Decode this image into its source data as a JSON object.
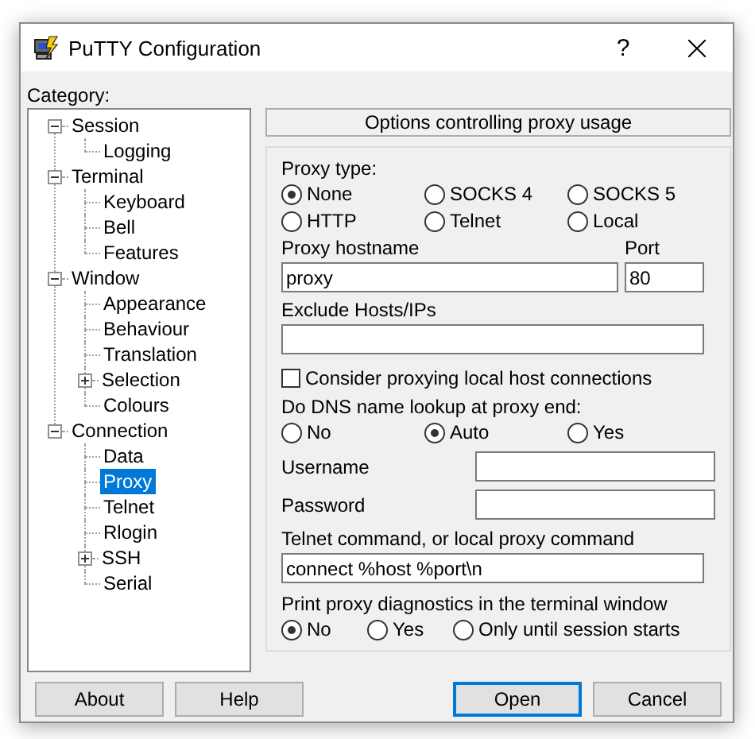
{
  "window": {
    "title": "PuTTY Configuration",
    "help_glyph": "?"
  },
  "category_label": "Category:",
  "tree": [
    {
      "label": "Session",
      "expanded": true,
      "selected": false,
      "children": [
        {
          "label": "Logging",
          "selected": false
        }
      ]
    },
    {
      "label": "Terminal",
      "expanded": true,
      "selected": false,
      "children": [
        {
          "label": "Keyboard",
          "selected": false
        },
        {
          "label": "Bell",
          "selected": false
        },
        {
          "label": "Features",
          "selected": false
        }
      ]
    },
    {
      "label": "Window",
      "expanded": true,
      "selected": false,
      "children": [
        {
          "label": "Appearance",
          "selected": false
        },
        {
          "label": "Behaviour",
          "selected": false
        },
        {
          "label": "Translation",
          "selected": false
        },
        {
          "label": "Selection",
          "expanded": false,
          "selected": false
        },
        {
          "label": "Colours",
          "selected": false
        }
      ]
    },
    {
      "label": "Connection",
      "expanded": true,
      "selected": false,
      "children": [
        {
          "label": "Data",
          "selected": false
        },
        {
          "label": "Proxy",
          "selected": true
        },
        {
          "label": "Telnet",
          "selected": false
        },
        {
          "label": "Rlogin",
          "selected": false
        },
        {
          "label": "SSH",
          "expanded": false,
          "selected": false
        },
        {
          "label": "Serial",
          "selected": false
        }
      ]
    }
  ],
  "panel_header": "Options controlling proxy usage",
  "proxy_type": {
    "label": "Proxy type:",
    "options": [
      {
        "label": "None",
        "selected": true
      },
      {
        "label": "SOCKS 4",
        "selected": false
      },
      {
        "label": "SOCKS 5",
        "selected": false
      },
      {
        "label": "HTTP",
        "selected": false
      },
      {
        "label": "Telnet",
        "selected": false
      },
      {
        "label": "Local",
        "selected": false
      }
    ]
  },
  "hostname": {
    "label": "Proxy hostname",
    "value": "proxy"
  },
  "port": {
    "label": "Port",
    "value": "80"
  },
  "exclude": {
    "label": "Exclude Hosts/IPs"
  },
  "local_connections": {
    "label": "Consider proxying local host connections",
    "checked": false
  },
  "dns_lookup": {
    "label": "Do DNS name lookup at proxy end:",
    "options": [
      {
        "label": "No",
        "selected": false
      },
      {
        "label": "Auto",
        "selected": true
      },
      {
        "label": "Yes",
        "selected": false
      }
    ]
  },
  "username": {
    "label": "Username"
  },
  "password": {
    "label": "Password"
  },
  "command": {
    "label": "Telnet command, or local proxy command",
    "value": "connect %host %port\\n"
  },
  "diagnostics": {
    "label": "Print proxy diagnostics in the terminal window",
    "options": [
      {
        "label": "No",
        "selected": true
      },
      {
        "label": "Yes",
        "selected": false
      },
      {
        "label": "Only until session starts",
        "selected": false
      }
    ]
  },
  "buttons": [
    {
      "label": "About",
      "default": false
    },
    {
      "label": "Help",
      "default": false
    },
    {
      "label": "Open",
      "default": true
    },
    {
      "label": "Cancel",
      "default": false
    }
  ]
}
